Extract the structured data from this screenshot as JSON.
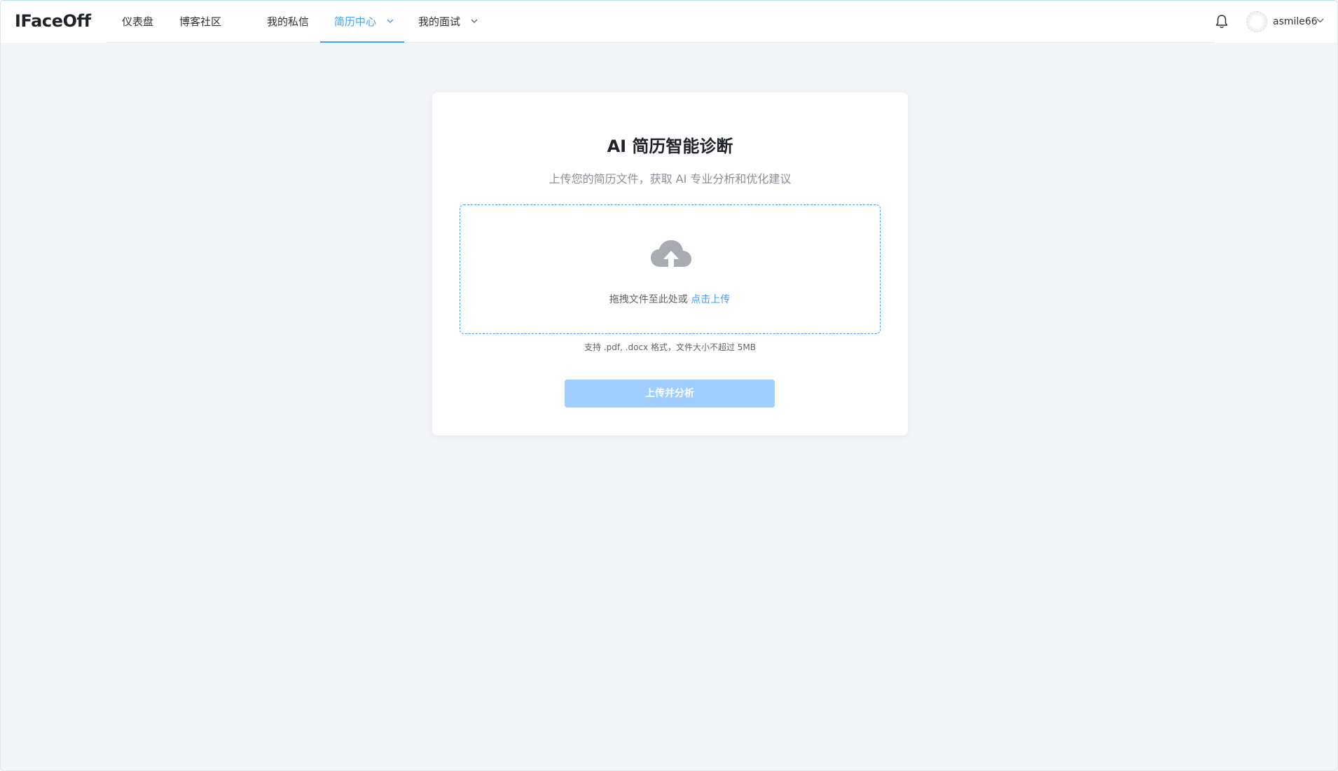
{
  "app": {
    "logo": "IFaceOff"
  },
  "nav": {
    "items": [
      {
        "label": "仪表盘"
      },
      {
        "label": "博客社区"
      },
      {
        "label": "我的私信"
      },
      {
        "label": "简历中心",
        "active": true,
        "has_dropdown": true
      },
      {
        "label": "我的面试",
        "has_dropdown": true
      }
    ]
  },
  "user": {
    "name": "asmile66",
    "notification_icon": "bell-icon",
    "menu_icon": "chevron-down-icon"
  },
  "card": {
    "title": "AI 简历智能诊断",
    "subtitle": "上传您的简历文件，获取 AI 专业分析和优化建议",
    "dropzone": {
      "icon": "cloud-upload-icon",
      "text": "拖拽文件至此处或",
      "link": "点击上传"
    },
    "hint": "支持 .pdf, .docx 格式，文件大小不超过 5MB",
    "button_label": "上传并分析"
  },
  "colors": {
    "accent": "#409eff",
    "button_disabled": "#a0cfff",
    "background": "#f3f5f8"
  }
}
